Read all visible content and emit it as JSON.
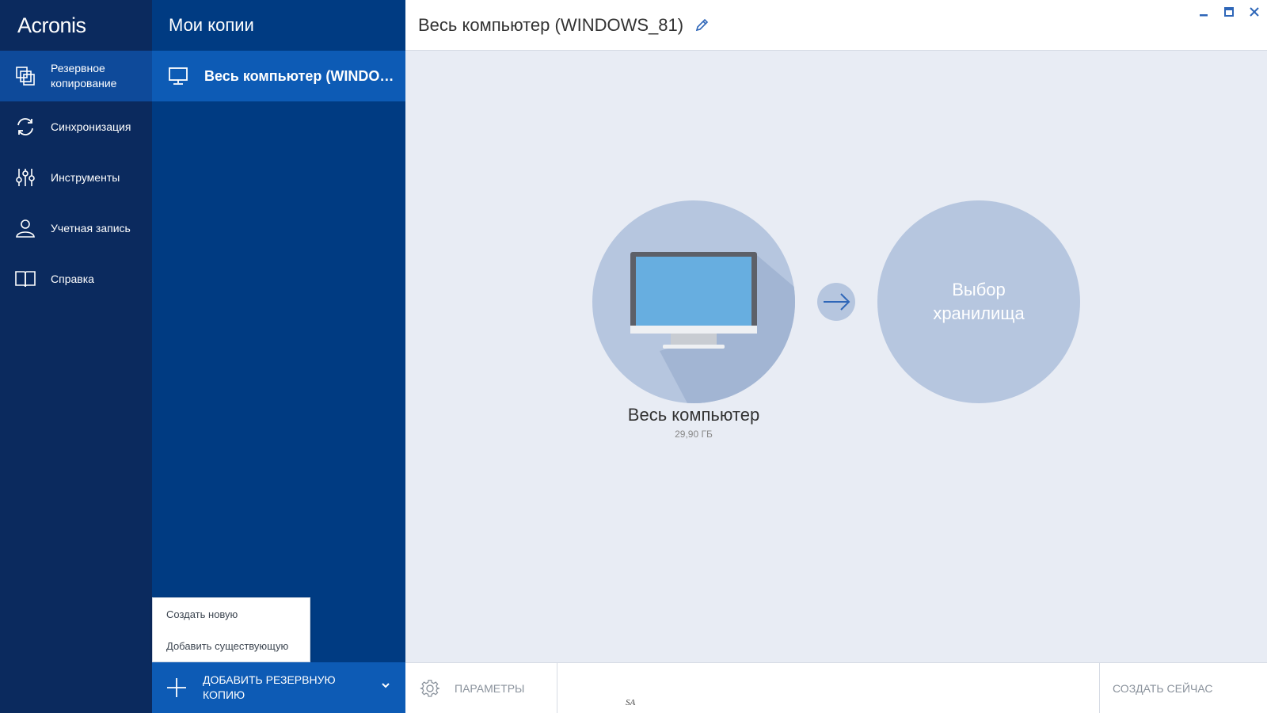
{
  "app": {
    "logo": "Acronis"
  },
  "nav": {
    "items": [
      {
        "label": "Резервное копирование",
        "icon": "backup-icon",
        "active": true
      },
      {
        "label": "Синхронизация",
        "icon": "sync-icon"
      },
      {
        "label": "Инструменты",
        "icon": "tools-icon"
      },
      {
        "label": "Учетная запись",
        "icon": "account-icon"
      },
      {
        "label": "Справка",
        "icon": "book-icon"
      }
    ]
  },
  "backups": {
    "header": "Мои копии",
    "items": [
      {
        "label": "Весь компьютер (WINDOWS_81)",
        "icon": "monitor-icon"
      }
    ]
  },
  "add_menu": {
    "items": [
      "Создать новую",
      "Добавить существующую"
    ]
  },
  "add_button": {
    "label": "ДОБАВИТЬ РЕЗЕРВНУЮ КОПИЮ"
  },
  "main": {
    "title": "Весь компьютер (WINDOWS_81)",
    "source_name": "Весь компьютер",
    "source_size": "29,90 ГБ",
    "destination_line1": "Выбор",
    "destination_line2": "хранилища"
  },
  "bottom": {
    "params_label": "ПАРАМЕТРЫ",
    "create_now_label": "СОЗДАТЬ СЕЙЧАС",
    "mark": "SA"
  },
  "colors": {
    "nav_bg": "#0b2a5e",
    "list_bg": "#003b82",
    "accent": "#0d5bb5",
    "circle": "#b6c6df",
    "screen": "#67aee0"
  }
}
